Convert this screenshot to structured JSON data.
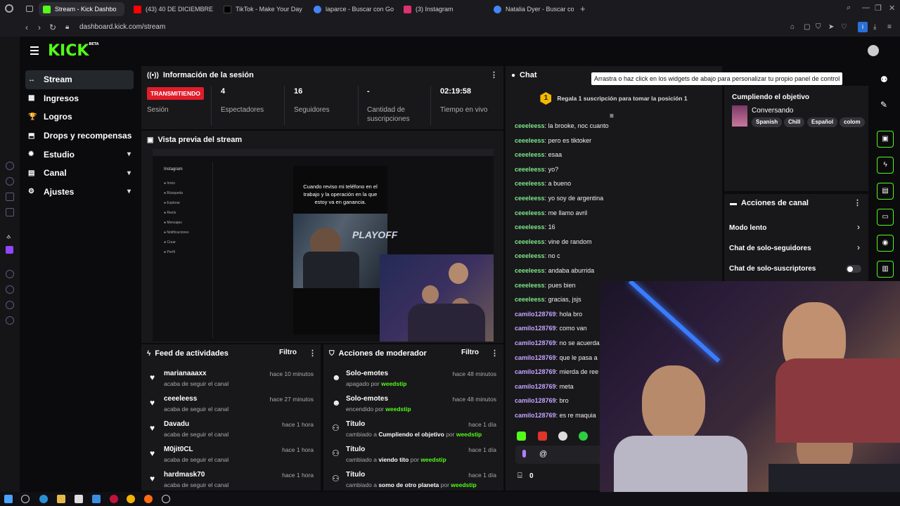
{
  "browser": {
    "tabs": [
      {
        "title": "Stream - Kick Dashbo",
        "active": true,
        "color": "#53fc18"
      },
      {
        "title": "(43) 40 DE DICIEMBRE | ",
        "color": "#ff0000"
      },
      {
        "title": "TikTok - Make Your Day",
        "color": "#000000"
      },
      {
        "title": "laparce - Buscar con Go",
        "color": "#4285f4"
      },
      {
        "title": "(3) Instagram",
        "color": "#e1306c"
      },
      {
        "title": "Natalia Dyer - Buscar con",
        "color": "#4285f4"
      }
    ],
    "new_tab": "+",
    "url": "dashboard.kick.com/stream"
  },
  "header": {
    "logo": "KICK",
    "logo_sup": "BETA"
  },
  "nav": {
    "items": [
      {
        "label": "Stream",
        "icon": "↔",
        "selected": true
      },
      {
        "label": "Ingresos",
        "icon": "▦"
      },
      {
        "label": "Logros",
        "icon": "🏆"
      },
      {
        "label": "Drops y recompensas",
        "icon": "⬒"
      },
      {
        "label": "Estudio",
        "icon": "✹",
        "chevron": true
      },
      {
        "label": "Canal",
        "icon": "▤",
        "chevron": true
      },
      {
        "label": "Ajustes",
        "icon": "⚙",
        "chevron": true
      }
    ]
  },
  "session": {
    "title": "Información de la sesión",
    "status": "TRANSMITIENDO",
    "status_label": "Sesión",
    "stats": [
      {
        "value": "4",
        "label": "Espectadores"
      },
      {
        "value": "16",
        "label": "Seguidores"
      },
      {
        "value": "-",
        "label": "Cantidad de suscripciones"
      },
      {
        "value": "02:19:58",
        "label": "Tiempo en vivo"
      }
    ]
  },
  "preview": {
    "title": "Vista previa del stream",
    "caption": "Cuando reviso mi teléfono en el trabajo y la operación en la que estoy va en ganancia.",
    "overlay_text": "PLAYOFF"
  },
  "feed": {
    "title": "Feed de actividades",
    "filter": "Filtro",
    "items": [
      {
        "name": "marianaaaxx",
        "sub": "acaba de seguir el canal",
        "time": "hace 10 minutos"
      },
      {
        "name": "ceeeleess",
        "sub": "acaba de seguir el canal",
        "time": "hace 27 minutos"
      },
      {
        "name": "Davadu",
        "sub": "acaba de seguir el canal",
        "time": "hace 1 hora"
      },
      {
        "name": "M0jit0CL",
        "sub": "acaba de seguir el canal",
        "time": "hace 1 hora"
      },
      {
        "name": "hardmask70",
        "sub": "acaba de seguir el canal",
        "time": "hace 1 hora"
      }
    ]
  },
  "mod": {
    "title": "Acciones de moderador",
    "filter": "Filtro",
    "items": [
      {
        "name": "Solo-emotes",
        "pre": "apagado por ",
        "mid": "",
        "post": "",
        "by": "weedstip",
        "time": "hace 48 minutos"
      },
      {
        "name": "Solo-emotes",
        "pre": "encendido por ",
        "mid": "",
        "post": "",
        "by": "weedstip",
        "time": "hace 48 minutos"
      },
      {
        "name": "Título",
        "pre": "cambiado a ",
        "mid": "Cumpliendo el objetivo",
        "post": " por ",
        "by": "weedstip",
        "time": "hace 1 día"
      },
      {
        "name": "Título",
        "pre": "cambiado a ",
        "mid": "viendo tito",
        "post": " por ",
        "by": "weedstip",
        "time": "hace 1 día"
      },
      {
        "name": "Título",
        "pre": "cambiado a ",
        "mid": "somo de otro planeta",
        "post": " por ",
        "by": "weedstip",
        "time": "hace 1 día"
      }
    ]
  },
  "chat": {
    "title": "Chat",
    "pinned_badge": "1",
    "pinned": "Regala 1 suscripción para tomar la posición 1",
    "messages": [
      {
        "user": "ceeeleess",
        "text": "la brooke, noc cuanto",
        "c": 1
      },
      {
        "user": "ceeeleess",
        "text": "pero es tiktoker",
        "c": 1
      },
      {
        "user": "ceeeleess",
        "text": "esaa",
        "c": 1
      },
      {
        "user": "ceeeleess",
        "text": "yo?",
        "c": 1
      },
      {
        "user": "ceeeleess",
        "text": "a bueno",
        "c": 1
      },
      {
        "user": "ceeeleess",
        "text": "yo soy de argentina",
        "c": 1
      },
      {
        "user": "ceeeleess",
        "text": "me llamo avril",
        "c": 1
      },
      {
        "user": "ceeeleess",
        "text": "16",
        "c": 1
      },
      {
        "user": "ceeeleess",
        "text": "vine de random",
        "c": 1
      },
      {
        "user": "ceeeleess",
        "text": "no c",
        "c": 1
      },
      {
        "user": "ceeeleess",
        "text": "andaba aburrida",
        "c": 1
      },
      {
        "user": "ceeeleess",
        "text": "pues bien",
        "c": 1
      },
      {
        "user": "ceeeleess",
        "text": "gracias, jsjs",
        "c": 1
      },
      {
        "user": "camilo128769",
        "text": "hola bro",
        "c": 2
      },
      {
        "user": "camilo128769",
        "text": "como van",
        "c": 2
      },
      {
        "user": "camilo128769",
        "text": "no se acuerda",
        "c": 2
      },
      {
        "user": "camilo128769",
        "text": "que le pasa a",
        "c": 2
      },
      {
        "user": "camilo128769",
        "text": "mierda de ree",
        "c": 2
      },
      {
        "user": "camilo128769",
        "text": "meta",
        "c": 2
      },
      {
        "user": "camilo128769",
        "text": "bro",
        "c": 2
      },
      {
        "user": "camilo128769",
        "text": "es re maquia",
        "c": 2
      }
    ],
    "input_value": "@",
    "gift_count": "0"
  },
  "tooltip": "Arrastra o haz click en los widgets de abajo para personalizar tu propio panel de control",
  "goal": {
    "title": "Cumpliendo el objetivo",
    "category": "Conversando",
    "tags": [
      "Spanish",
      "Chill",
      "Español",
      "colom"
    ]
  },
  "actions": {
    "title": "Acciones de canal",
    "rows": [
      {
        "label": "Modo lento",
        "type": "arrow"
      },
      {
        "label": "Chat de solo-seguidores",
        "type": "arrow"
      },
      {
        "label": "Chat de solo-suscriptores",
        "type": "toggle",
        "on": false
      }
    ]
  },
  "colors": {
    "accent": "#53fc18",
    "live": "#e11d2a",
    "panel": "#18181b"
  }
}
